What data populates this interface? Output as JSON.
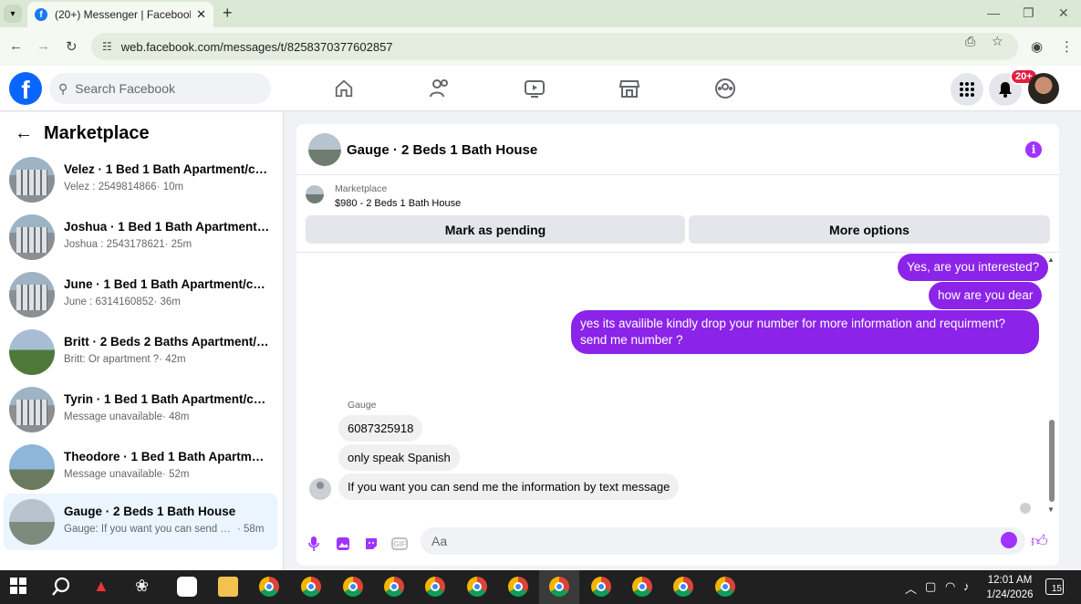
{
  "browser": {
    "tab_title": "(20+) Messenger | Facebook",
    "url": "web.facebook.com/messages/t/8258370377602857"
  },
  "fb": {
    "search_placeholder": "Search Facebook",
    "notifications_badge": "20+"
  },
  "sidebar": {
    "title": "Marketplace",
    "conversations": [
      {
        "name": "Velez · 1 Bed 1 Bath Apartment/co...",
        "preview": "Velez : 2549814866",
        "time": "· 10m"
      },
      {
        "name": "Joshua · 1 Bed 1 Bath Apartment/c...",
        "preview": "Joshua : 2543178621",
        "time": "· 25m"
      },
      {
        "name": "June · 1 Bed 1 Bath Apartment/con...",
        "preview": "June : 6314160852",
        "time": "· 36m"
      },
      {
        "name": "Britt · 2 Beds 2 Baths Apartment/c...",
        "preview": "Britt: Or apartment ?",
        "time": "· 42m"
      },
      {
        "name": "Tyrin · 1 Bed 1 Bath Apartment/con...",
        "preview": "Message unavailable",
        "time": "· 48m"
      },
      {
        "name": "Theodore · 1 Bed 1 Bath Apartmen...",
        "preview": "Message unavailable",
        "time": "· 52m"
      },
      {
        "name": "Gauge · 2 Beds 1 Bath House",
        "preview": "Gauge: If you want you can send m...",
        "time": "· 58m"
      }
    ]
  },
  "chat": {
    "title": "Gauge · 2 Beds 1 Bath House",
    "marketplace_label": "Marketplace",
    "listing": "$980 - 2 Beds 1 Bath House",
    "mark_pending": "Mark as pending",
    "more_options": "More options",
    "outgoing": [
      "Yes, are you interested?",
      "how are you dear",
      "yes its availible kindly drop your number for more information and requirment?send me number ?"
    ],
    "sender_name": "Gauge",
    "incoming": [
      "6087325918",
      "only speak Spanish",
      "If you want you can send me the information by text message"
    ],
    "composer_placeholder": "Aa"
  },
  "taskbar": {
    "time": "12:01 AM",
    "date": "1/24/2026",
    "notif_count": "15"
  }
}
